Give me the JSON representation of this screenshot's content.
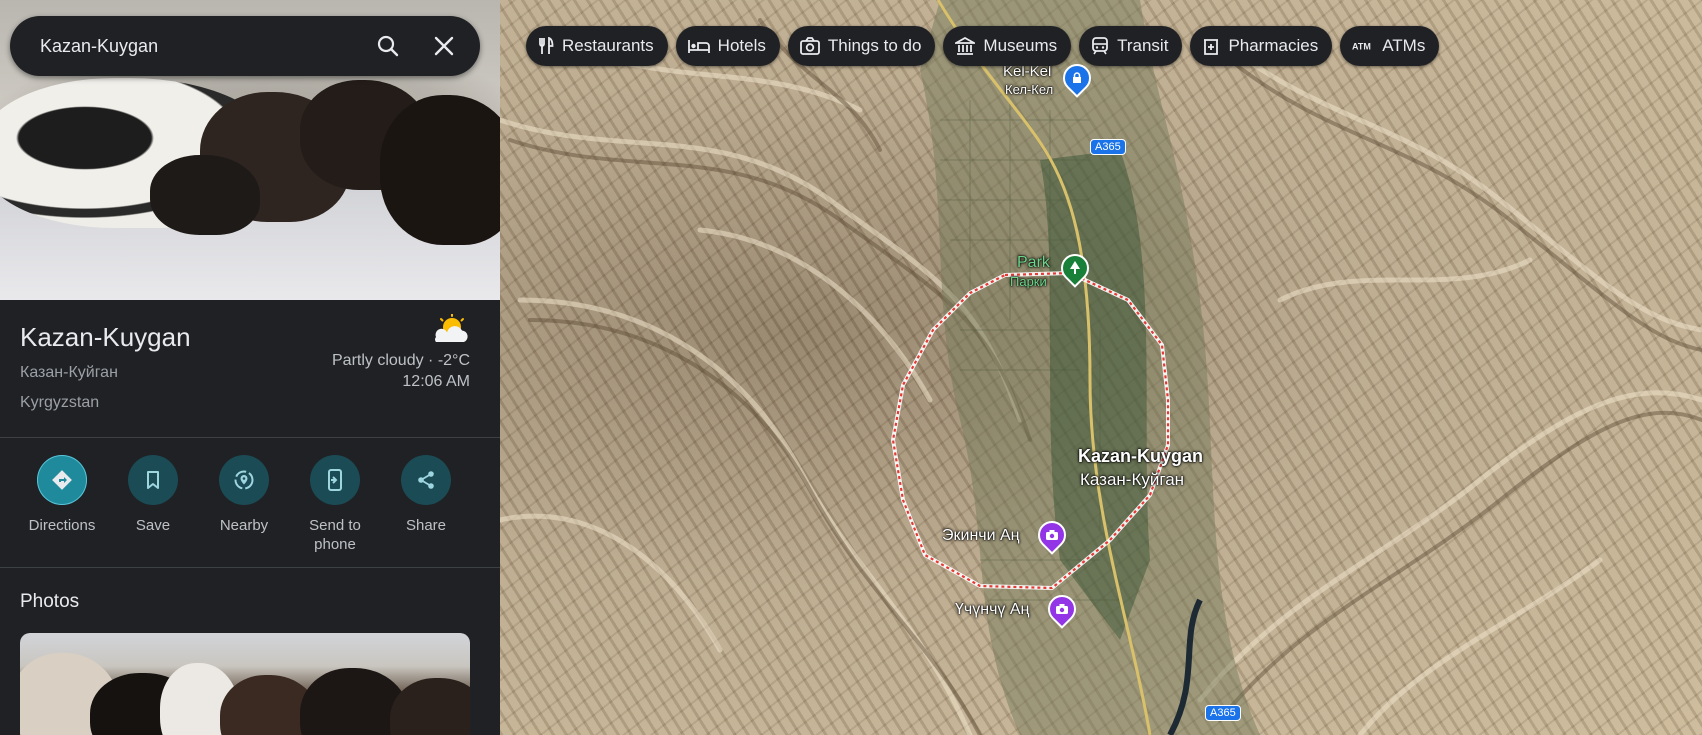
{
  "search": {
    "value": "Kazan-Kuygan",
    "search_icon": "search-icon",
    "close_icon": "close-icon"
  },
  "place": {
    "title": "Kazan-Kuygan",
    "local_name": "Казан-Куйган",
    "country": "Kyrgyzstan",
    "weather": {
      "icon": "partly-cloudy-icon",
      "text": "Partly cloudy · -2°C",
      "time": "12:06 AM"
    }
  },
  "actions": [
    {
      "label": "Directions",
      "icon": "directions-icon"
    },
    {
      "label": "Save",
      "icon": "bookmark-icon"
    },
    {
      "label": "Nearby",
      "icon": "nearby-icon"
    },
    {
      "label": "Send to phone",
      "icon": "send-to-phone-icon"
    },
    {
      "label": "Share",
      "icon": "share-icon"
    }
  ],
  "photos": {
    "heading": "Photos"
  },
  "chips": [
    {
      "label": "Restaurants",
      "icon": "restaurant-icon"
    },
    {
      "label": "Hotels",
      "icon": "hotel-icon"
    },
    {
      "label": "Things to do",
      "icon": "camera-icon"
    },
    {
      "label": "Museums",
      "icon": "museum-icon"
    },
    {
      "label": "Transit",
      "icon": "transit-icon"
    },
    {
      "label": "Pharmacies",
      "icon": "pharmacy-icon"
    },
    {
      "label": "ATMs",
      "icon": "atm-icon"
    }
  ],
  "map": {
    "labels": {
      "kelkel": "Kel-Kel",
      "kelkel_local": "Кел-Кел",
      "park": "Park",
      "park_local": "Парки",
      "city": "Kazan-Kuygan",
      "city_local": "Казан-Куйган",
      "ekinchi": "Экинчи Аң",
      "uchunchu": "Үчүнчү Аң"
    },
    "road_shields": [
      "A365",
      "A365"
    ],
    "colors": {
      "boundary": "#e53935",
      "park_pin": "#188038",
      "attraction_pin": "#9334e6",
      "shield": "#1a73e8",
      "accent": "#1e8a9c"
    }
  }
}
